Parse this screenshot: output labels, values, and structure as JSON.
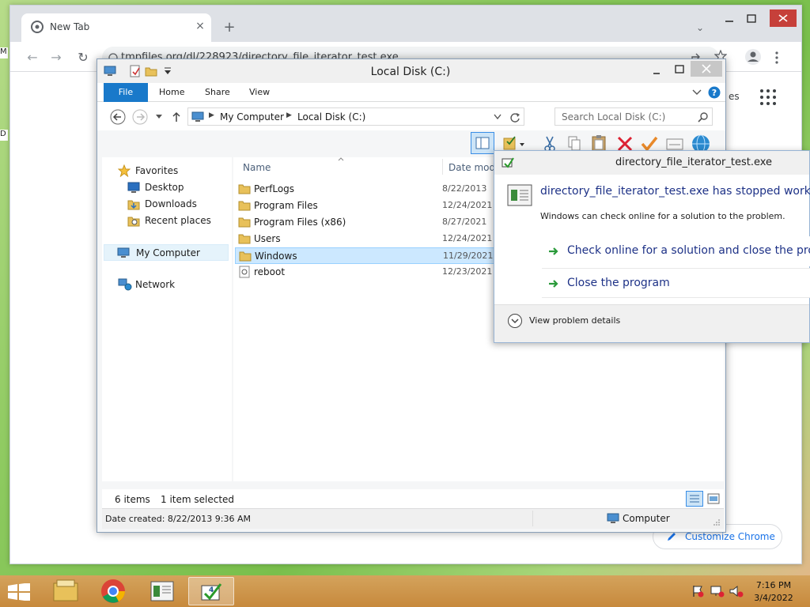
{
  "desktop": {
    "stub_left_a": "M",
    "stub_left_b": "D"
  },
  "chrome": {
    "tab_title": "New Tab",
    "tab_close": "×",
    "new_tab": "+",
    "tab_search": "⌄",
    "url": "tmpfiles.org/dl/228923/directory_file_iterator_test.exe",
    "ntp_partial_label": "es",
    "customize_label": "Customize Chrome"
  },
  "explorer": {
    "title": "Local Disk (C:)",
    "ribbon_tabs": {
      "file": "File",
      "home": "Home",
      "share": "Share",
      "view": "View"
    },
    "breadcrumb": {
      "root": "My Computer",
      "current": "Local Disk (C:)"
    },
    "search_placeholder": "Search Local Disk (C:)",
    "nav": {
      "favorites": "Favorites",
      "desktop": "Desktop",
      "downloads": "Downloads",
      "recent": "Recent places",
      "computer": "My Computer",
      "network": "Network"
    },
    "columns": {
      "name": "Name",
      "date": "Date modi"
    },
    "files": [
      {
        "name": "PerfLogs",
        "date": "8/22/2013",
        "type": "folder"
      },
      {
        "name": "Program Files",
        "date": "12/24/2021",
        "type": "folder"
      },
      {
        "name": "Program Files (x86)",
        "date": "8/27/2021",
        "type": "folder"
      },
      {
        "name": "Users",
        "date": "12/24/2021",
        "type": "folder"
      },
      {
        "name": "Windows",
        "date": "11/29/2021",
        "type": "folder",
        "selected": true
      },
      {
        "name": "reboot",
        "date": "12/23/2021",
        "type": "shortcut"
      }
    ],
    "status": {
      "item_count": "6 items",
      "selected_count": "1 item selected",
      "date_created": "Date created: 8/22/2013 9:36 AM",
      "location": "Computer"
    }
  },
  "error_dialog": {
    "title": "directory_file_iterator_test.exe",
    "heading": "directory_file_iterator_test.exe has stopped working",
    "subtext": "Windows can check online for a solution to the problem.",
    "option_check": "Check online for a solution and close the program",
    "option_close": "Close the program",
    "details_label": "View problem details"
  },
  "taskbar": {
    "time": "7:16 PM",
    "date": "3/4/2022"
  },
  "colors": {
    "explorer_file_tab": "#1979ca",
    "error_link": "#1e3287",
    "chrome_link": "#1a73e8",
    "selection": "#cce8ff"
  }
}
